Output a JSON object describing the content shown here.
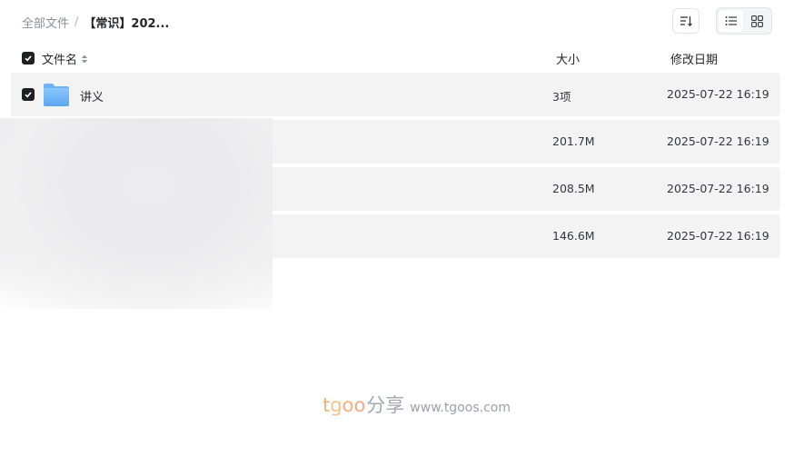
{
  "breadcrumb": {
    "root": "全部文件",
    "separator": "/",
    "current": "【常识】202..."
  },
  "toolbar": {
    "sort_icon": "sort-list-icon",
    "list_view_icon": "list-view-icon",
    "grid_view_icon": "grid-view-icon"
  },
  "table": {
    "headers": {
      "name": "文件名",
      "size": "大小",
      "date": "修改日期"
    },
    "rows": [
      {
        "name": "讲义",
        "size": "3项",
        "date": "2025-07-22 16:19",
        "checked": true,
        "icon": "folder-icon"
      },
      {
        "name": "",
        "size": "201.7M",
        "date": "2025-07-22 16:19",
        "checked": false
      },
      {
        "name": "",
        "size": "208.5M",
        "date": "2025-07-22 16:19",
        "checked": false
      },
      {
        "name": "",
        "size": "146.6M",
        "date": "2025-07-22 16:19",
        "checked": false
      }
    ]
  },
  "watermark": {
    "brand_t": "t",
    "brand_g": "g",
    "brand_o1": "o",
    "brand_o2": "o",
    "share": "分享",
    "url": "www.tgoos.com"
  },
  "colors": {
    "row_bg": "#f3f3f4",
    "checkbox": "#1f2024",
    "folder": "#7ab8f5",
    "watermark_orange": "#f1b27a"
  }
}
